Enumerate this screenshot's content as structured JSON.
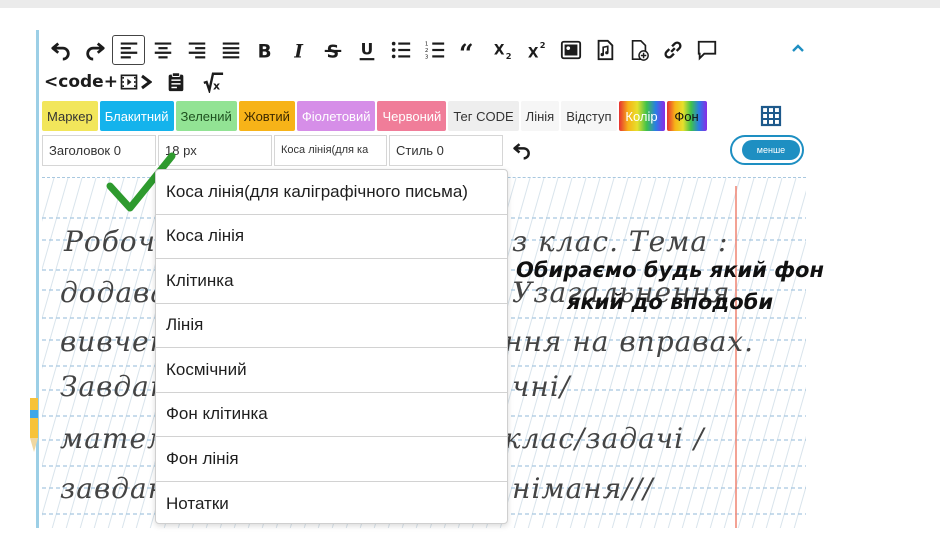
{
  "toolbar": {
    "code_label": "<code+",
    "colors": [
      {
        "label": "Маркер",
        "cls": "c-yellow"
      },
      {
        "label": "Блакитний",
        "cls": "c-blue"
      },
      {
        "label": "Зелений",
        "cls": "c-green"
      },
      {
        "label": "Жовтий",
        "cls": "c-orange"
      },
      {
        "label": "Фіолетовий",
        "cls": "c-violet"
      },
      {
        "label": "Червоний",
        "cls": "c-red"
      },
      {
        "label": "Тег CODE",
        "cls": "c-grey"
      },
      {
        "label": "Лінія",
        "cls": "c-plain"
      },
      {
        "label": "Відступ",
        "cls": "c-plain"
      },
      {
        "label": "Колір",
        "cls": "c-rainbow"
      },
      {
        "label": "Фон",
        "cls": "c-rainbow2"
      }
    ],
    "heading_select": "Заголовок 0",
    "size_select": "18 px",
    "line_select": "Коса лінія(для ка",
    "style_select": "Стиль 0",
    "toggle_label": "менше"
  },
  "dropdown": {
    "items": [
      "Коса лінія(для каліграфічного письма)",
      "Коса лінія",
      "Клітинка",
      "Лінія",
      "Космічний",
      "Фон клітинка",
      "Фон лінія",
      "Нотатки"
    ]
  },
  "handwriting": {
    "line1a": "Робочий",
    "line1b": "з клас. Тема :",
    "line2a": "додаван",
    "line2b": "Узагальнення",
    "line3a": "вивченог",
    "line3b": "ння на вправах.",
    "line4a": "Завдан",
    "line4b": "чні/",
    "line5a": "матем",
    "line5b": "клас/задачі /",
    "line6a": "завдань",
    "line6b": "німаня///"
  },
  "overlay": {
    "line1": "Обираємо будь який фон",
    "line2": "який до вподоби"
  },
  "colors": {
    "accent": "#1e8fc2",
    "margin_line": "#f08a7a",
    "ruling": "#a8c8e0"
  }
}
